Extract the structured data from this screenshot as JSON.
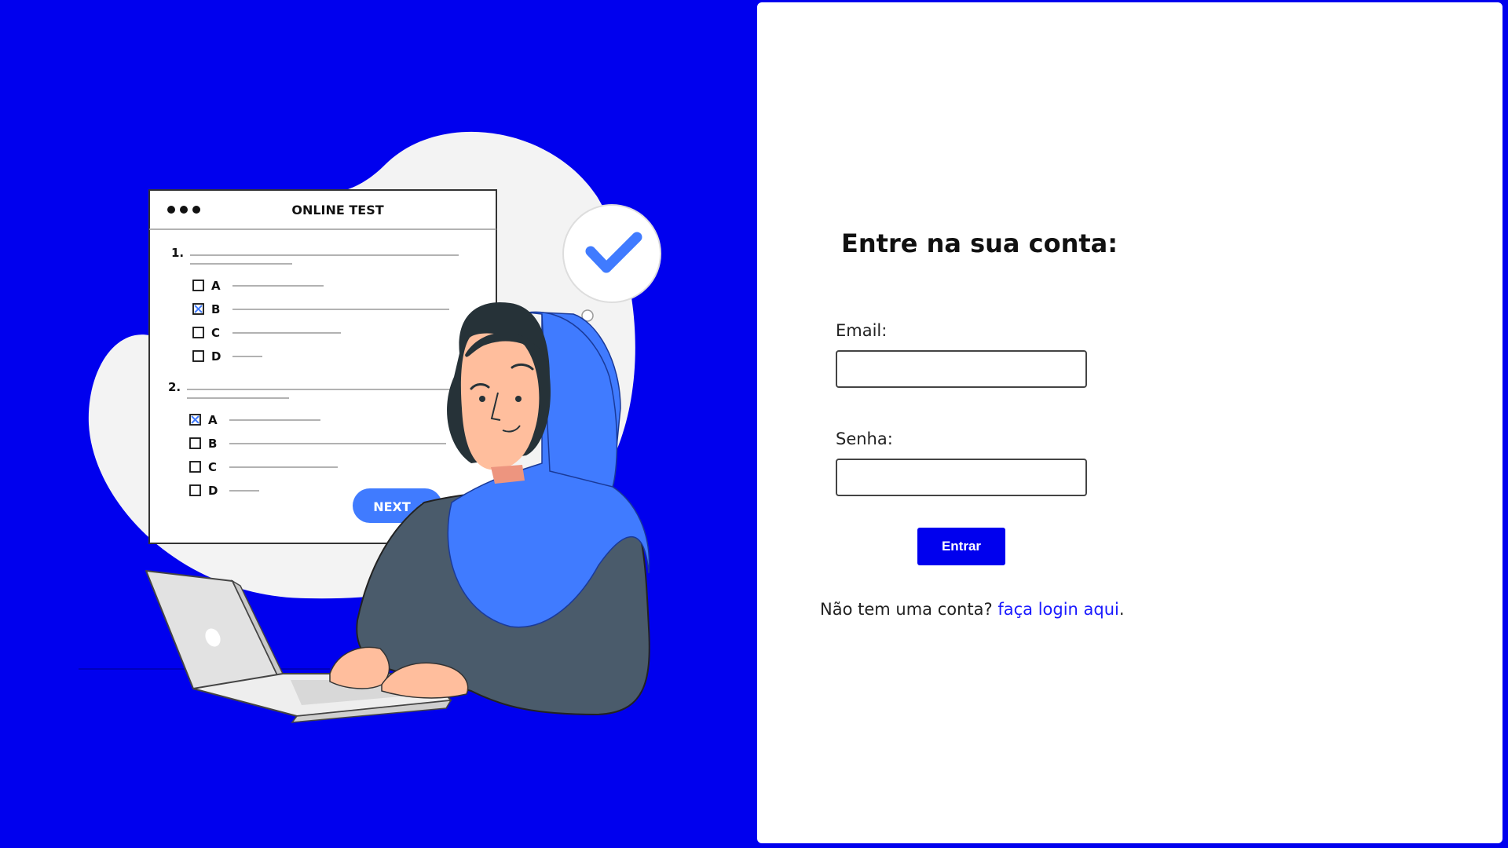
{
  "illustration": {
    "window_title": "ONLINE TEST",
    "questions": [
      {
        "number": "1.",
        "options": [
          "A",
          "B",
          "C",
          "D"
        ],
        "checked": "B"
      },
      {
        "number": "2.",
        "options": [
          "A",
          "B",
          "C",
          "D"
        ],
        "checked": "A"
      }
    ],
    "next_button": "NEXT",
    "next_chevron": ">",
    "check_icon": "checkmark-icon"
  },
  "login": {
    "title": "Entre na sua conta:",
    "email_label": "Email:",
    "email_value": "",
    "password_label": "Senha:",
    "password_value": "",
    "submit_label": "Entrar",
    "signup_prefix": "Não tem uma conta?",
    "signup_link": "faça login aqui",
    "signup_suffix": "."
  },
  "colors": {
    "brand_blue": "#0000ee",
    "accent_blue": "#407bff",
    "link_blue": "#1a1aff"
  }
}
